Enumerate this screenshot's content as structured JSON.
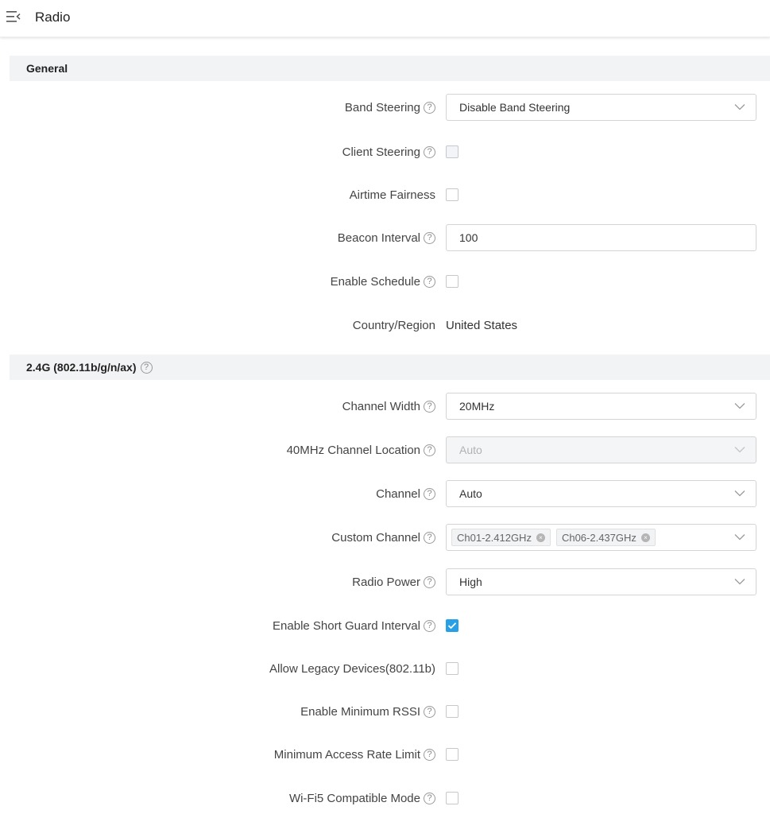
{
  "header": {
    "title": "Radio",
    "menu_icon": "menu-collapse-icon"
  },
  "general": {
    "title": "General",
    "band_steering": {
      "label": "Band Steering",
      "value": "Disable Band Steering"
    },
    "client_steering": {
      "label": "Client Steering",
      "checked": false
    },
    "airtime_fairness": {
      "label": "Airtime Fairness",
      "checked": false
    },
    "beacon_interval": {
      "label": "Beacon Interval",
      "value": "100"
    },
    "enable_schedule": {
      "label": "Enable Schedule",
      "checked": false
    },
    "country": {
      "label": "Country/Region",
      "value": "United States"
    }
  },
  "band24": {
    "title": "2.4G (802.11b/g/n/ax)",
    "channel_width": {
      "label": "Channel Width",
      "value": "20MHz"
    },
    "channel_location": {
      "label": "40MHz Channel Location",
      "value": "Auto",
      "disabled": true
    },
    "channel": {
      "label": "Channel",
      "value": "Auto"
    },
    "custom_channel": {
      "label": "Custom Channel",
      "tags": [
        "Ch01-2.412GHz",
        "Ch06-2.437GHz"
      ]
    },
    "radio_power": {
      "label": "Radio Power",
      "value": "High"
    },
    "short_guard": {
      "label": "Enable Short Guard Interval",
      "checked": true
    },
    "legacy_devices": {
      "label": "Allow Legacy Devices(802.11b)",
      "checked": false
    },
    "min_rssi": {
      "label": "Enable Minimum RSSI",
      "checked": false
    },
    "min_rate": {
      "label": "Minimum Access Rate Limit",
      "checked": false
    },
    "wifi5": {
      "label": "Wi-Fi5 Compatible Mode",
      "checked": false
    }
  },
  "help_glyph": "?",
  "tag_remove_glyph": "×",
  "colors": {
    "accent": "#27a0e6",
    "section_bg": "#f2f3f5",
    "border": "#d4d4d4"
  }
}
